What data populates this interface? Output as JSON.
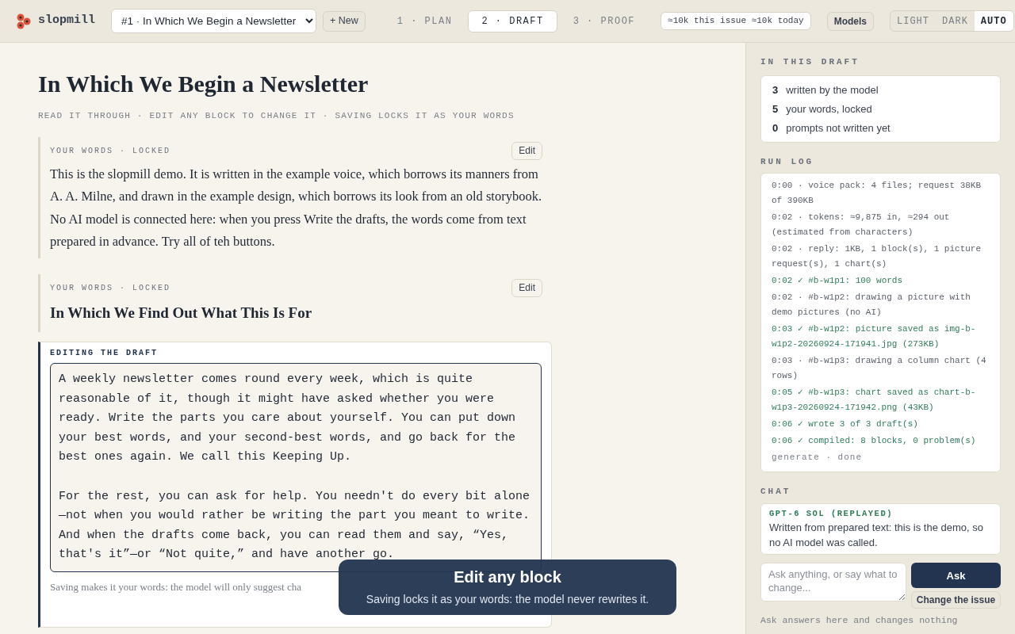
{
  "brand": "slopmill",
  "issue_select": {
    "value": "#1 · In Which We Begin a Newsletter"
  },
  "new_button": "+ New",
  "steps": [
    {
      "label": "1 · PLAN",
      "selected": false
    },
    {
      "label": "2 · DRAFT",
      "selected": true
    },
    {
      "label": "3 · PROOF",
      "selected": false
    }
  ],
  "usage": "≈10k this issue ≈10k today",
  "models_button": "Models",
  "theme": [
    {
      "label": "LIGHT",
      "selected": false
    },
    {
      "label": "DARK",
      "selected": false
    },
    {
      "label": "AUTO",
      "selected": true
    }
  ],
  "page": {
    "title": "In Which We Begin a Newsletter",
    "subtitle": "READ IT THROUGH · EDIT ANY BLOCK TO CHANGE IT · SAVING LOCKS IT AS YOUR WORDS"
  },
  "blocks": [
    {
      "kind": "paragraph",
      "label": "YOUR WORDS · LOCKED",
      "button": "Edit",
      "text": "This is the slopmill demo. It is written in the example voice, which borrows its manners from A. A. Milne, and drawn in the example design, which borrows its look from an old storybook. No AI model is connected here: when you press Write the drafts, the words come from text prepared in advance. Try all of teh buttons."
    },
    {
      "kind": "heading",
      "label": "YOUR WORDS · LOCKED",
      "button": "Edit",
      "text": "In Which We Find Out What This Is For"
    }
  ],
  "editor": {
    "label": "EDITING THE DRAFT",
    "value": "A weekly newsletter comes round every week, which is quite reasonable of it, though it might have asked whether you were ready. Write the parts you care about yourself. You can put down your best words, and your second-best words, and go back for the best ones again. We call this Keeping Up.\n\nFor the rest, you can ask for help. You needn't do every bit alone —not when you would rather be writing the part you meant to write. And when the drafts come back, you can read them and say, “Yes, that's it”—or “Not quite,” and have another go.",
    "hint": "Saving makes it your words: the model will only suggest cha"
  },
  "toast": {
    "title": "Edit any block",
    "text": "Saving locks it as your words: the model never rewrites it."
  },
  "sidebar": {
    "draft_heading": "IN THIS DRAFT",
    "counts": [
      {
        "count": "3",
        "label": "written by the model"
      },
      {
        "count": "5",
        "label": "your words, locked"
      },
      {
        "count": "0",
        "label": "prompts not written yet"
      }
    ],
    "log_heading": "RUN LOG",
    "log": [
      {
        "kind": "info",
        "text": "0:00 · voice pack: 4 files; request 38KB of 390KB"
      },
      {
        "kind": "info",
        "text": "0:02 · tokens: ≈9,875 in, ≈294 out (estimated from characters)"
      },
      {
        "kind": "info",
        "text": "0:02 · reply: 1KB, 1 block(s), 1 picture request(s), 1 chart(s)"
      },
      {
        "kind": "ok",
        "text": "0:02 ✓ #b-w1p1: 100 words"
      },
      {
        "kind": "info",
        "text": "0:02 · #b-w1p2: drawing a picture with demo pictures (no AI)"
      },
      {
        "kind": "ok",
        "text": "0:03 ✓ #b-w1p2: picture saved as img-b-w1p2-20260924-171941.jpg (273KB)"
      },
      {
        "kind": "info",
        "text": "0:03 · #b-w1p3: drawing a column chart (4 rows)"
      },
      {
        "kind": "ok",
        "text": "0:05 ✓ #b-w1p3: chart saved as chart-b-w1p3-20260924-171942.png (43KB)"
      },
      {
        "kind": "ok",
        "text": "0:06 ✓ wrote 3 of 3 draft(s)"
      },
      {
        "kind": "ok",
        "text": "0:06 ✓ compiled: 8 blocks, 0 problem(s)"
      },
      {
        "kind": "status",
        "text": "generate · done"
      }
    ],
    "chat_heading": "CHAT",
    "message": {
      "author": "GPT-6 SOL (REPLAYED)",
      "text": "Written from prepared text: this is the demo, so no AI model was called."
    },
    "input": {
      "placeholder": "Ask anything, or say what to change..."
    },
    "ask_button": "Ask",
    "change_button": "Change the issue",
    "footnote": "Ask answers here and changes nothing"
  }
}
